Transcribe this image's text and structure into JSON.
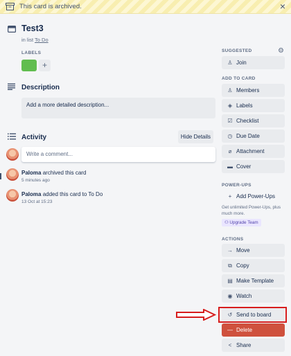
{
  "banner": {
    "text": "This card is archived."
  },
  "card": {
    "title": "Test3",
    "list_prefix": "in list",
    "list_name": "To Do",
    "labels_heading": "LABELS",
    "label_add": "+",
    "label_color": "#61bd4f"
  },
  "description": {
    "heading": "Description",
    "placeholder": "Add a more detailed description..."
  },
  "activity": {
    "heading": "Activity",
    "hide_details": "Hide Details",
    "comment_placeholder": "Write a comment...",
    "items": [
      {
        "user": "Paloma",
        "action": "archived this card",
        "time": "5 minutes ago"
      },
      {
        "user": "Paloma",
        "action": "added this card to To Do",
        "time": "13 Oct at 15:23"
      }
    ]
  },
  "sidebar": {
    "suggested": {
      "heading": "SUGGESTED",
      "join": "Join"
    },
    "add_to_card": {
      "heading": "ADD TO CARD",
      "items": [
        "Members",
        "Labels",
        "Checklist",
        "Due Date",
        "Attachment",
        "Cover"
      ]
    },
    "power_ups": {
      "heading": "POWER-UPS",
      "add": "Add Power-Ups",
      "text": "Get unlimited Power-Ups, plus much more.",
      "upgrade": "Upgrade Team"
    },
    "actions": {
      "heading": "ACTIONS",
      "items": [
        "Move",
        "Copy",
        "Make Template",
        "Watch",
        "Send to board",
        "Delete",
        "Share"
      ]
    }
  },
  "colors": {
    "delete": "#cf513d",
    "highlight": "#d71d1d",
    "background": "#f4f5f7"
  },
  "icons": [
    "archive-icon",
    "close-icon",
    "card-icon",
    "description-icon",
    "activity-icon",
    "gear-icon",
    "person-icon",
    "tag-icon",
    "checklist-icon",
    "clock-icon",
    "paperclip-icon",
    "cover-icon",
    "plus-icon",
    "arrow-right-icon",
    "copy-icon",
    "template-icon",
    "eye-icon",
    "restore-icon",
    "minus-icon",
    "share-icon"
  ]
}
